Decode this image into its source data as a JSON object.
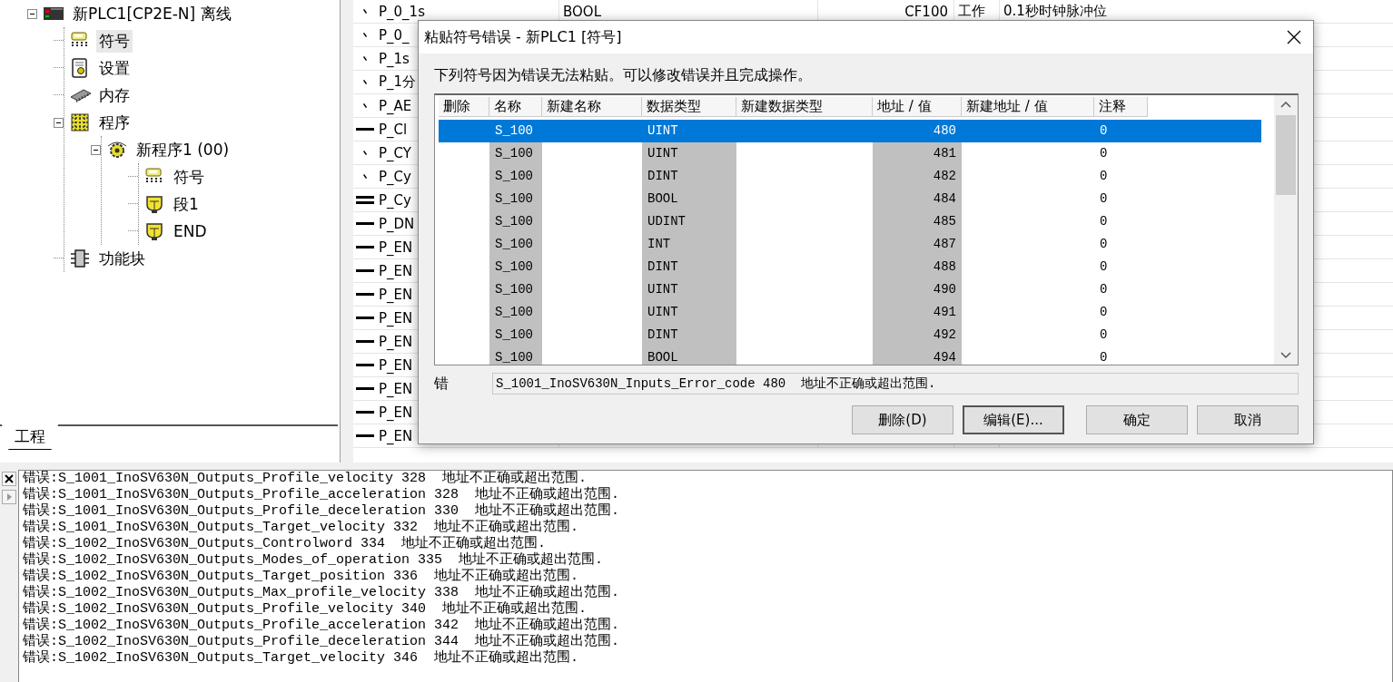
{
  "project_tree": {
    "items": [
      {
        "label": "新PLC1[CP2E-N] 离线",
        "kind": "plc",
        "expanded": true,
        "selected": false,
        "children": [
          {
            "label": "符号",
            "kind": "symbols",
            "selected": true
          },
          {
            "label": "设置",
            "kind": "settings",
            "selected": false
          },
          {
            "label": "内存",
            "kind": "memory",
            "selected": false
          },
          {
            "label": "程序",
            "kind": "programs",
            "expanded": true,
            "selected": false,
            "children": [
              {
                "label": "新程序1 (00)",
                "kind": "program",
                "expanded": true,
                "selected": false,
                "children": [
                  {
                    "label": "符号",
                    "kind": "symbols",
                    "selected": false
                  },
                  {
                    "label": "段1",
                    "kind": "section",
                    "selected": false
                  },
                  {
                    "label": "END",
                    "kind": "section",
                    "selected": false
                  }
                ]
              }
            ]
          },
          {
            "label": "功能块",
            "kind": "function_blocks",
            "selected": false
          }
        ]
      }
    ]
  },
  "project_tabs": [
    {
      "label": "工程",
      "selected": true
    }
  ],
  "symbol_table": {
    "rows": [
      {
        "kind": "bit",
        "name": "P_0_1s",
        "data_type": "BOOL",
        "address": "CF100",
        "column_4": "工作",
        "column_5": "0.1秒时钟脉冲位"
      },
      {
        "kind": "bit",
        "name": "P_0_"
      },
      {
        "kind": "bit",
        "name": "P_1s"
      },
      {
        "kind": "bit",
        "name": "P_1分"
      },
      {
        "kind": "bit",
        "name": "P_AE"
      },
      {
        "kind": "word",
        "name": "P_Cl"
      },
      {
        "kind": "bit",
        "name": "P_CY"
      },
      {
        "kind": "bit",
        "name": "P_Cy"
      },
      {
        "kind": "dword",
        "name": "P_Cy"
      },
      {
        "kind": "word",
        "name": "P_DN"
      },
      {
        "kind": "word",
        "name": "P_EN"
      },
      {
        "kind": "word",
        "name": "P_EN"
      },
      {
        "kind": "word",
        "name": "P_EN"
      },
      {
        "kind": "word",
        "name": "P_EN"
      },
      {
        "kind": "word",
        "name": "P_EN"
      },
      {
        "kind": "word",
        "name": "P_EN"
      },
      {
        "kind": "word",
        "name": "P_EN"
      },
      {
        "kind": "word",
        "name": "P_EN"
      },
      {
        "kind": "word",
        "name": "P_EN"
      }
    ]
  },
  "dialog": {
    "title": "粘贴符号错误 - 新PLC1 [符号]",
    "message": "下列符号因为错误无法粘贴。可以修改错误并且完成操作。",
    "columns": [
      "删除",
      "名称",
      "新建名称",
      "数据类型",
      "新建数据类型",
      "地址 / 值",
      "新建地址 / 值",
      "注释"
    ],
    "rows": [
      {
        "name": "S_100",
        "data_type": "UINT",
        "address": "480",
        "comment": "0",
        "selected": true
      },
      {
        "name": "S_100",
        "data_type": "UINT",
        "address": "481",
        "comment": "0",
        "selected": false
      },
      {
        "name": "S_100",
        "data_type": "DINT",
        "address": "482",
        "comment": "0",
        "selected": false
      },
      {
        "name": "S_100",
        "data_type": "BOOL",
        "address": "484",
        "comment": "0",
        "selected": false
      },
      {
        "name": "S_100",
        "data_type": "UDINT",
        "address": "485",
        "comment": "0",
        "selected": false
      },
      {
        "name": "S_100",
        "data_type": "INT",
        "address": "487",
        "comment": "0",
        "selected": false
      },
      {
        "name": "S_100",
        "data_type": "DINT",
        "address": "488",
        "comment": "0",
        "selected": false
      },
      {
        "name": "S_100",
        "data_type": "UINT",
        "address": "490",
        "comment": "0",
        "selected": false
      },
      {
        "name": "S_100",
        "data_type": "UINT",
        "address": "491",
        "comment": "0",
        "selected": false
      },
      {
        "name": "S_100",
        "data_type": "DINT",
        "address": "492",
        "comment": "0",
        "selected": false
      },
      {
        "name": "S_100",
        "data_type": "BOOL",
        "address": "494",
        "comment": "0",
        "selected": false
      }
    ],
    "error_label": "错",
    "error_text": "S_1001_InoSV630N_Inputs_Error_code 480  地址不正确或超出范围.",
    "buttons": [
      {
        "label": "删除(D)",
        "focused": false
      },
      {
        "label": "编辑(E)...",
        "focused": true
      },
      {
        "label": "确定",
        "focused": false
      },
      {
        "label": "取消",
        "focused": false
      }
    ]
  },
  "output_log": {
    "lines": [
      "错误:S_1001_InoSV630N_Outputs_Profile_velocity 328  地址不正确或超出范围.",
      "错误:S_1001_InoSV630N_Outputs_Profile_acceleration 328  地址不正确或超出范围.",
      "错误:S_1001_InoSV630N_Outputs_Profile_deceleration 330  地址不正确或超出范围.",
      "错误:S_1001_InoSV630N_Outputs_Target_velocity 332  地址不正确或超出范围.",
      "错误:S_1002_InoSV630N_Outputs_Controlword 334  地址不正确或超出范围.",
      "错误:S_1002_InoSV630N_Outputs_Modes_of_operation 335  地址不正确或超出范围.",
      "错误:S_1002_InoSV630N_Outputs_Target_position 336  地址不正确或超出范围.",
      "错误:S_1002_InoSV630N_Outputs_Max_profile_velocity 338  地址不正确或超出范围.",
      "错误:S_1002_InoSV630N_Outputs_Profile_velocity 340  地址不正确或超出范围.",
      "错误:S_1002_InoSV630N_Outputs_Profile_acceleration 342  地址不正确或超出范围.",
      "错误:S_1002_InoSV630N_Outputs_Profile_deceleration 344  地址不正确或超出范围.",
      "错误:S_1002_InoSV630N_Outputs_Target_velocity 346  地址不正确或超出范围."
    ]
  }
}
